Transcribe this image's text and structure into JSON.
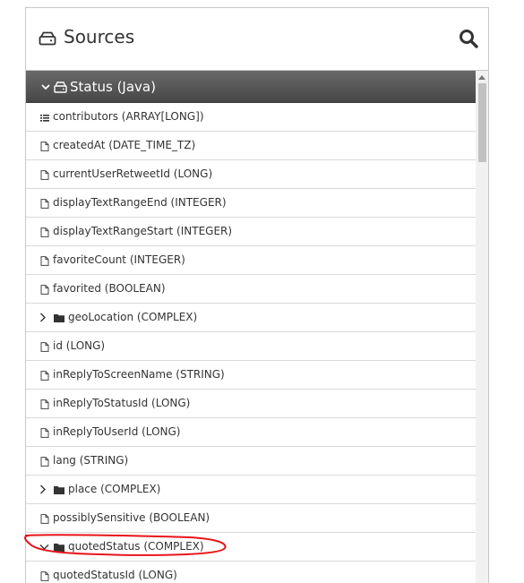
{
  "header": {
    "title": "Sources",
    "icon": "drive-icon",
    "search_icon": "search-icon"
  },
  "group": {
    "label": "Status (Java)",
    "expanded": true
  },
  "fields": [
    {
      "label": "contributors (ARRAY[LONG])",
      "kind": "array"
    },
    {
      "label": "createdAt (DATE_TIME_TZ)",
      "kind": "field"
    },
    {
      "label": "currentUserRetweetId (LONG)",
      "kind": "field"
    },
    {
      "label": "displayTextRangeEnd (INTEGER)",
      "kind": "field"
    },
    {
      "label": "displayTextRangeStart (INTEGER)",
      "kind": "field"
    },
    {
      "label": "favoriteCount (INTEGER)",
      "kind": "field"
    },
    {
      "label": "favorited (BOOLEAN)",
      "kind": "field"
    },
    {
      "label": "geoLocation (COMPLEX)",
      "kind": "complex",
      "expanded": false
    },
    {
      "label": "id (LONG)",
      "kind": "field"
    },
    {
      "label": "inReplyToScreenName (STRING)",
      "kind": "field"
    },
    {
      "label": "inReplyToStatusId (LONG)",
      "kind": "field"
    },
    {
      "label": "inReplyToUserId (LONG)",
      "kind": "field"
    },
    {
      "label": "lang (STRING)",
      "kind": "field"
    },
    {
      "label": "place (COMPLEX)",
      "kind": "complex",
      "expanded": false
    },
    {
      "label": "possiblySensitive (BOOLEAN)",
      "kind": "field"
    },
    {
      "label": "quotedStatus (COMPLEX)",
      "kind": "complex",
      "expanded": true
    },
    {
      "label": "quotedStatusId (LONG)",
      "kind": "field"
    }
  ],
  "colors": {
    "group_bg": "#555555",
    "annotation": "#e8141b"
  }
}
